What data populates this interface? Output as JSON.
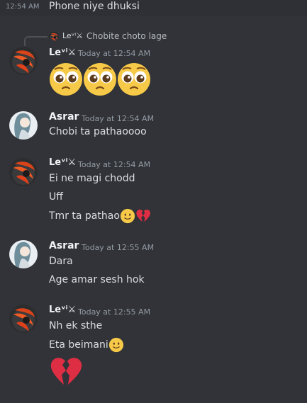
{
  "previous": {
    "time": "12:54 AM",
    "text": "Phone niye dhuksi"
  },
  "reply": {
    "author": "Leᵛⁱ⚔",
    "text": "Chobite choto lage"
  },
  "messages": [
    {
      "author": "Leᵛⁱ⚔",
      "time": "Today at 12:54 AM",
      "lines": [],
      "emojis": [
        "pleading-face-emoji",
        "pleading-face-emoji",
        "pleading-face-emoji"
      ]
    },
    {
      "author": "Asrar",
      "time": "Today at 12:54 AM",
      "lines": [
        "Chobi ta pathaoooo"
      ]
    },
    {
      "author": "Leᵛⁱ⚔",
      "time": "Today at 12:54 AM",
      "lines": [
        "Ei ne magi chodd",
        "Uff",
        "Tmr ta pathao"
      ]
    },
    {
      "author": "Asrar",
      "time": "Today at 12:55 AM",
      "lines": [
        "Dara",
        "Age amar sesh hok"
      ]
    },
    {
      "author": "Leᵛⁱ⚔",
      "time": "Today at 12:55 AM",
      "lines": [
        "Nh ek sthe",
        "Eta beimani"
      ]
    }
  ],
  "colors": {
    "background": "#313338",
    "highlight_row": "#2e3035",
    "text": "#dbdee1",
    "muted": "#949ba4",
    "emoji_yellow": "#f7c948",
    "broken_heart": "#dd2e44"
  },
  "icons": {
    "levi_avatar": "red-flower-avatar",
    "asrar_avatar": "girl-sketch-avatar",
    "broken_heart": "broken-heart-emoji",
    "smile": "slightly-smiling-face-emoji"
  }
}
